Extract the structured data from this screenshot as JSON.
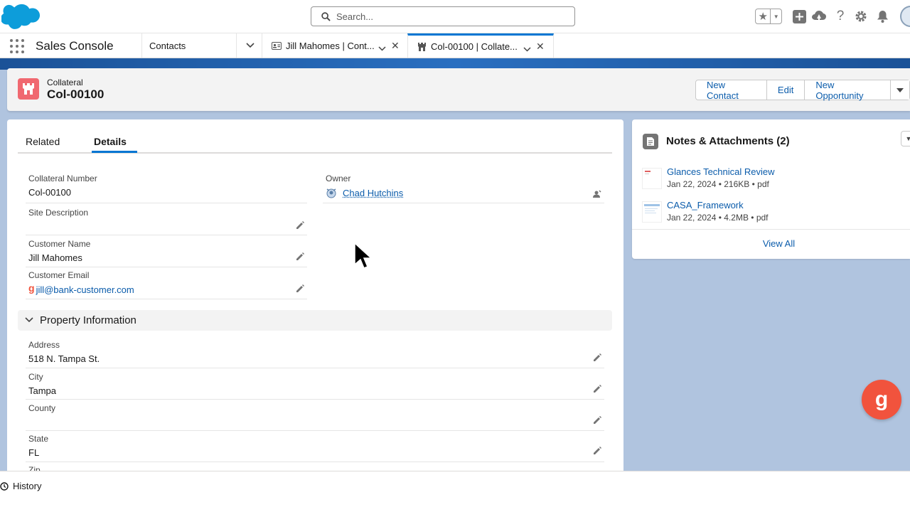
{
  "header": {
    "search_placeholder": "Search..."
  },
  "nav": {
    "app_name": "Sales Console",
    "nav_item": "Contacts",
    "tabs": [
      {
        "label": "Jill Mahomes | Cont..."
      },
      {
        "label": "Col-00100 | Collate..."
      }
    ]
  },
  "record": {
    "type": "Collateral",
    "title": "Col-00100",
    "actions": [
      "New Contact",
      "Edit",
      "New Opportunity"
    ]
  },
  "detail_tabs": {
    "related": "Related",
    "details": "Details"
  },
  "fields": {
    "collateral_number_label": "Collateral Number",
    "collateral_number": "Col-00100",
    "owner_label": "Owner",
    "owner": "Chad Hutchins",
    "site_description_label": "Site Description",
    "site_description": "",
    "customer_name_label": "Customer Name",
    "customer_name": "Jill Mahomes",
    "customer_email_label": "Customer Email",
    "customer_email": "jill@bank-customer.com"
  },
  "property_section": {
    "title": "Property Information",
    "address_label": "Address",
    "address": "518 N. Tampa St.",
    "city_label": "City",
    "city": "Tampa",
    "county_label": "County",
    "county": "",
    "state_label": "State",
    "state": "FL",
    "zip_label": "Zip"
  },
  "notes": {
    "title": "Notes & Attachments (2)",
    "files": [
      {
        "name": "Glances Technical Review",
        "meta": "Jan 22, 2024  •  216KB  •  pdf"
      },
      {
        "name": "CASA_Framework",
        "meta": "Jan 22, 2024  •  4.2MB  •  pdf"
      }
    ],
    "view_all": "View All"
  },
  "utility": {
    "history": "History"
  },
  "fab_glyph": "g",
  "email_badge_glyph": "g",
  "colors": {
    "brand_blue": "#0176d3",
    "link_blue": "#0b5cab",
    "collateral_icon": "#f06870",
    "fab": "#f1533d"
  }
}
